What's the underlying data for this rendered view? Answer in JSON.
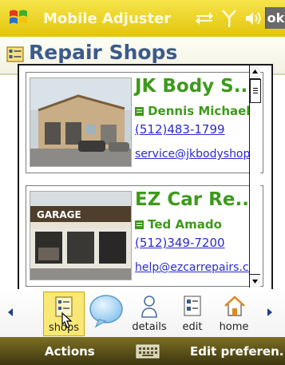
{
  "statusbar": {
    "app_title": "Mobile Adjuster",
    "ok_label": "ok",
    "icons": [
      "windows-start-icon",
      "network-icon",
      "signal-icon",
      "volume-icon"
    ]
  },
  "header": {
    "title": "Repair Shops",
    "icon": "list-icon"
  },
  "shops": [
    {
      "name": "JK Body S...",
      "contact": "Dennis Michaels",
      "phone": "(512)483-1799",
      "email": "service@jkbodyshop.",
      "photo_sign": ""
    },
    {
      "name": "EZ Car Re...",
      "contact": "Ted Amado",
      "phone": "(512)349-7200",
      "email": "help@ezcarrepairs.co",
      "photo_sign": "GARAGE"
    }
  ],
  "toolbar": {
    "items": [
      {
        "label": "shops",
        "icon": "shops-icon",
        "selected": true
      },
      {
        "label": "",
        "icon": "chat-bubble-icon",
        "selected": false
      },
      {
        "label": "details",
        "icon": "person-icon",
        "selected": false
      },
      {
        "label": "edit",
        "icon": "edit-icon",
        "selected": false
      },
      {
        "label": "home",
        "icon": "home-icon",
        "selected": false
      }
    ]
  },
  "softkeys": {
    "left": "Actions",
    "right": "Edit preferen...",
    "center_icon": "keyboard-icon"
  },
  "colors": {
    "title_bar": "#e6c915",
    "header_text": "#3b5a8c",
    "shop_name": "#3d9a1a",
    "link": "#2a2ad0",
    "softkey_bar": "#4e4514"
  }
}
